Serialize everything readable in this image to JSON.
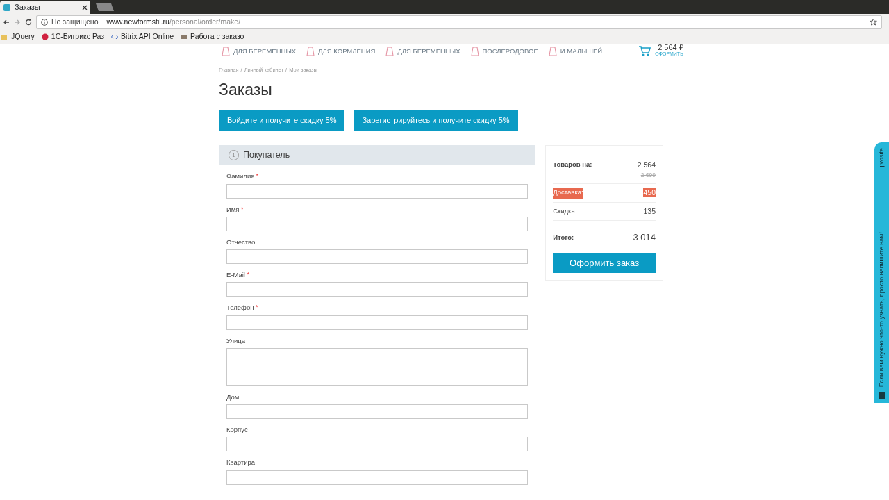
{
  "browser": {
    "tab_title": "Заказы",
    "security": "Не защищено",
    "url_host": "www.newformstil.ru",
    "url_path": "/personal/order/make/",
    "bookmarks": [
      {
        "label": "JQuery"
      },
      {
        "label": "1С-Битрикс Раз"
      },
      {
        "label": "Bitrix API Online"
      },
      {
        "label": "Работа с заказо"
      }
    ]
  },
  "header": {
    "nav": [
      {
        "label": "ДЛЯ БЕРЕМЕННЫХ"
      },
      {
        "label": "ДЛЯ КОРМЛЕНИЯ"
      },
      {
        "label": "ДЛЯ БЕРЕМЕННЫХ"
      },
      {
        "label": "ПОСЛЕРОДОВОЕ"
      },
      {
        "label": "И МАЛЫШЕЙ"
      }
    ],
    "cart_total": "2 564 ₽",
    "cart_link": "ОФОРМИТЬ"
  },
  "breadcrumbs": [
    "Главная",
    "Личный кабинет",
    "Мои заказы"
  ],
  "breadcrumb_separator": "/",
  "title": "Заказы",
  "promo_buttons": [
    "Войдите и получите скидку 5%",
    "Зарегистрируйтесь и получите скидку 5%"
  ],
  "section": {
    "number": "1",
    "title": "Покупатель"
  },
  "required_mark": "*",
  "fields": [
    {
      "label": "Фамилия",
      "required": true,
      "kind": "input"
    },
    {
      "label": "Имя",
      "required": true,
      "kind": "input"
    },
    {
      "label": "Отчество",
      "required": false,
      "kind": "input"
    },
    {
      "label": "E-Mail",
      "required": true,
      "kind": "input"
    },
    {
      "label": "Телефон",
      "required": true,
      "kind": "input"
    },
    {
      "label": "Улица",
      "required": false,
      "kind": "textarea"
    },
    {
      "label": "Дом",
      "required": false,
      "kind": "input"
    },
    {
      "label": "Корпус",
      "required": false,
      "kind": "input"
    },
    {
      "label": "Квартира",
      "required": false,
      "kind": "input"
    }
  ],
  "summary": {
    "rows": [
      {
        "label": "Товаров на:",
        "value": "2 564",
        "old_value": "2 699",
        "bold": true,
        "highlighted": false
      },
      {
        "label": "Доставка:",
        "value": "450",
        "bold": false,
        "highlighted": true
      },
      {
        "label": "Скидка:",
        "value": "135",
        "bold": false,
        "highlighted": false
      }
    ],
    "total_label": "Итого:",
    "total_value": "3 014",
    "checkout_button": "Оформить заказ"
  },
  "chat_widget": {
    "brand": "jivosite",
    "message": "Если вам нужно что-то узнать, просто напишите нам!"
  }
}
